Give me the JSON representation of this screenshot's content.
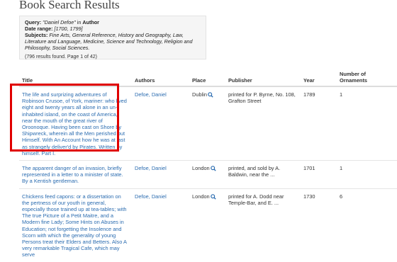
{
  "page_title": "Book Search Results",
  "query": {
    "query_label": "Query:",
    "query_value": "\"Daniel Defoe\"",
    "query_in": " in ",
    "query_field": "Author",
    "date_label": "Date range:",
    "date_value": "[1700, 1799]",
    "subjects_label": "Subjects:",
    "subjects_value": "Fine Arts, General Reference, History and Geography, Law, Literature and Language, Medicine, Science and Technology, Religion and Philosophy, Social Sciences.",
    "results_count": "(796 results found. Page 1 of 42)"
  },
  "columns": {
    "title": "Title",
    "authors": "Authors",
    "place": "Place",
    "publisher": "Publisher",
    "year": "Year",
    "ornaments": "Number of Ornaments"
  },
  "rows": [
    {
      "title": "The life and surprizing adventures of Robinson Crusoe, of York, mariner: who lived eight and twenty years all alone in an un-inhabited island, on the coast of America, near the mouth of the great river of Oroonoque. Having been cast on Shore by Shipwreck, wherein all the Men perished but Himself. With An Account how he was at last as strangely deliver'd by Pirates. Written by himself. Part I.",
      "author": "Defoe, Daniel",
      "place": "Dublin",
      "publisher": "printed for P. Byrne, No. 108, Grafton Street",
      "year": "1789",
      "ornaments": "1"
    },
    {
      "title": "The apparent danger of an invasion, briefly represented in a letter to a minister of state. By a Kentish gentleman.",
      "author": "Defoe, Daniel",
      "place": "London",
      "publisher": "printed, and sold by A. Baldwin, near the ...",
      "year": "1701",
      "ornaments": "1"
    },
    {
      "title": "Chickens feed capons: or a dissertation on the pertness of our youth in general, especially those trained up at tea-tables; with The true Picture of a Petit Maitre, and a Modern fine Lady; Some Hints on Abuses in Education; not forgetting the Insolence and Scorn with which the generality of young Persons treat their Elders and Betters. Also A very remarkable Tragical Cafe, which may serve",
      "author": "Defoe, Daniel",
      "place": "London",
      "publisher": "printed for A. Dodd near Temple-Bar, and E. ...",
      "year": "1730",
      "ornaments": "6"
    }
  ],
  "icons": {
    "place_search": "search-icon"
  },
  "colors": {
    "link": "#2b6cb0",
    "highlight": "#e00000",
    "query_bg": "#f5f5f5"
  }
}
